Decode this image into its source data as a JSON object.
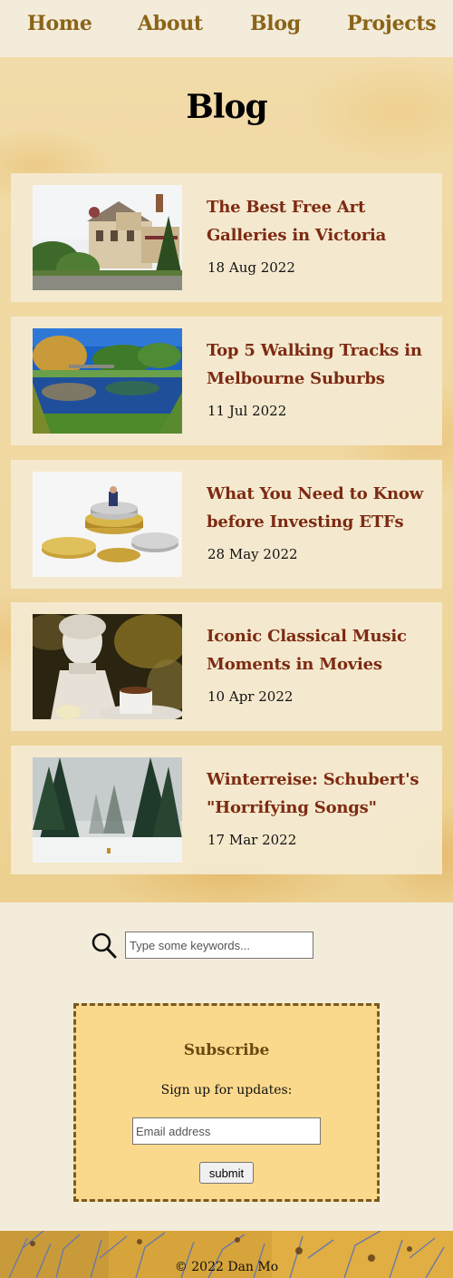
{
  "nav": {
    "items": [
      {
        "label": "Home"
      },
      {
        "label": "About"
      },
      {
        "label": "Blog"
      },
      {
        "label": "Projects"
      }
    ]
  },
  "page": {
    "title": "Blog"
  },
  "posts": [
    {
      "title": "The Best Free Art Galleries in Victoria",
      "date": "18 Aug 2022",
      "thumb_icon": "mansion-photo"
    },
    {
      "title": "Top 5 Walking Tracks in Melbourne Suburbs",
      "date": "11 Jul 2022",
      "thumb_icon": "river-photo"
    },
    {
      "title": "What You Need to Know before Investing ETFs",
      "date": "28 May 2022",
      "thumb_icon": "coins-photo"
    },
    {
      "title": "Iconic Classical Music Moments in Movies",
      "date": "10 Apr 2022",
      "thumb_icon": "bust-photo"
    },
    {
      "title": "Winterreise: Schubert's \"Horrifying Songs\"",
      "date": "17 Mar 2022",
      "thumb_icon": "snow-forest-photo"
    }
  ],
  "search": {
    "placeholder": "Type some keywords...",
    "value": ""
  },
  "subscribe": {
    "title": "Subscribe",
    "text": "Sign up for updates:",
    "email_placeholder": "Email address",
    "submit_label": "submit"
  },
  "footer": {
    "text": "© 2022 Dan Mo"
  },
  "colors": {
    "accent": "#8a6418",
    "post_title": "#7d2a12",
    "subscribe_bg": "#fbd98c"
  }
}
